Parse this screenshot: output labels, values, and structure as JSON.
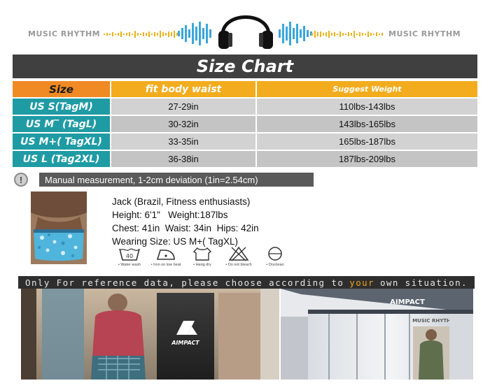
{
  "banner": {
    "brand_left": "MUSIC RHYTHM",
    "brand_right": "MUSIC RHYTHM",
    "accent": "#e9b21a",
    "wave_color": "#3aa6dc"
  },
  "size_chart": {
    "title": "Size Chart",
    "headers": {
      "size": "Size",
      "waist": "fit body waist",
      "weight": "Suggest Weight"
    },
    "rows": [
      {
        "size": "US S(TagM)",
        "waist": "27-29in",
        "weight": "110lbs-143lbs"
      },
      {
        "size": "US M‾ (TagL)",
        "waist": "30-32in",
        "weight": "143lbs-165lbs"
      },
      {
        "size": "US M+( TagXL)",
        "waist": "33-35in",
        "weight": "165lbs-187lbs"
      },
      {
        "size": "US L (Tag2XL)",
        "waist": "36-38in",
        "weight": "187lbs-209lbs"
      }
    ],
    "colors": {
      "title_bg": "#404040",
      "size_header": "#f08a24",
      "other_header": "#f2ac1e",
      "size_cell": "#1f9ba4",
      "value_cell": "#d2d2d2"
    }
  },
  "note": {
    "icon": "exclamation-icon",
    "text": "Manual measurement, 1-2cm deviation (1in=2.54cm)"
  },
  "model": {
    "line1": "Jack (Brazil, Fitness enthusiasts)",
    "line2": "Height: 6'1\"   Weight:187lbs",
    "line3": "Chest: 41in  Waist: 34in  Hips: 42in",
    "line4": "Wearing Size: US M+( TagXL)"
  },
  "care": [
    {
      "icon": "water-wash-40-icon",
      "label": "• Water wash",
      "value": "40"
    },
    {
      "icon": "iron-low-heat-icon",
      "label": "• Iron on low heat"
    },
    {
      "icon": "hang-dry-icon",
      "label": "• Hang dry"
    },
    {
      "icon": "do-not-bleach-icon",
      "label": "• Do not bleach"
    },
    {
      "icon": "dryclean-icon",
      "label": "• Dryclean"
    }
  ],
  "reference": {
    "before": "Only For reference data, please choose according to",
    "highlight": "your",
    "after": "own situation."
  },
  "store": {
    "logo_left": "AIMPACT",
    "logo_right": "AIMPACT",
    "shop_sign": "MUSIC RHYTHM"
  }
}
